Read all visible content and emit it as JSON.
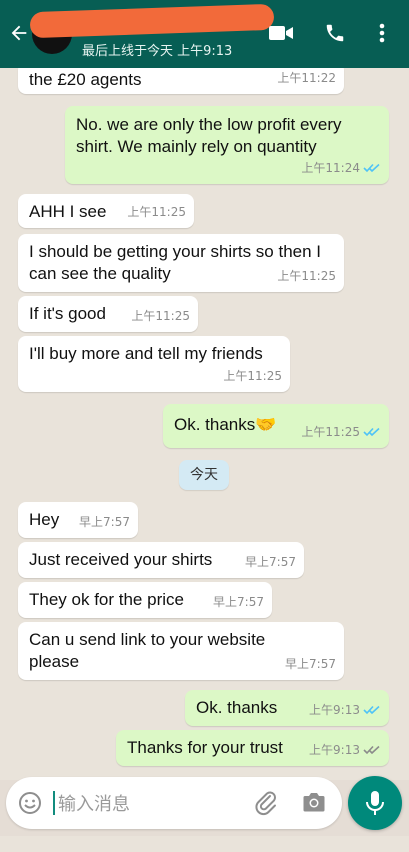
{
  "header": {
    "status": "最后上线于今天 上午9:13",
    "icons": [
      "back-arrow-icon",
      "video-call-icon",
      "phone-icon",
      "more-vert-icon"
    ]
  },
  "messages": [
    {
      "side": "in",
      "text": "the £20 agents",
      "time": "上午11:22",
      "ticks": false
    },
    {
      "side": "out",
      "text": "No. we are only the low profit every shirt. We mainly rely on quantity",
      "time": "上午11:24",
      "ticks": "read"
    },
    {
      "side": "in",
      "text": "AHH I see",
      "time": "上午11:25",
      "ticks": false
    },
    {
      "side": "in",
      "text": "I should be getting your shirts so then I can see the quality",
      "time": "上午11:25",
      "ticks": false
    },
    {
      "side": "in",
      "text": "If it's good",
      "time": "上午11:25",
      "ticks": false
    },
    {
      "side": "in",
      "text": "I'll buy more and tell my friends",
      "time": "上午11:25",
      "ticks": false
    },
    {
      "side": "out",
      "text": "Ok. thanks🤝",
      "time": "上午11:25",
      "ticks": "read"
    },
    {
      "side": "in",
      "text": "Hey",
      "time": "早上7:57",
      "ticks": false
    },
    {
      "side": "in",
      "text": "Just received your shirts",
      "time": "早上7:57",
      "ticks": false
    },
    {
      "side": "in",
      "text": "They ok for the price",
      "time": "早上7:57",
      "ticks": false
    },
    {
      "side": "in",
      "text": "Can u send link to your website please",
      "time": "早上7:57",
      "ticks": false
    },
    {
      "side": "out",
      "text": "Ok. thanks",
      "time": "上午9:13",
      "ticks": "read"
    },
    {
      "side": "out",
      "text": "Thanks for your trust",
      "time": "上午9:13",
      "ticks": "delivered"
    }
  ],
  "day_divider": "今天",
  "input": {
    "placeholder": "输入消息",
    "icons": [
      "emoji-icon",
      "attach-icon",
      "camera-icon",
      "mic-icon"
    ]
  },
  "colors": {
    "header": "#075e54",
    "outgoing": "#dcf8c6",
    "incoming": "#ffffff",
    "read_tick": "#4fc3f7",
    "mic_button": "#00897b"
  }
}
